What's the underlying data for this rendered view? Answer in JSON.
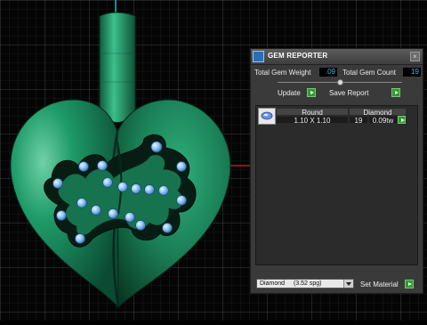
{
  "window": {
    "title": "GEM REPORTER",
    "close_glyph": "×"
  },
  "stats": {
    "weight_label": "Total Gem Weight",
    "weight_value": ".09",
    "count_label": "Total Gem Count",
    "count_value": "19"
  },
  "slider": {
    "level": 0.5
  },
  "actions": {
    "update_label": "Update",
    "save_label": "Save Report"
  },
  "gems": [
    {
      "shape": "Round",
      "material": "Diamond",
      "size": "1.10 X 1.10",
      "count": "19",
      "weight": "0.09tw"
    }
  ],
  "material": {
    "selected": "Diamond",
    "spg": "(3.52 spg)",
    "set_label": "Set Material"
  },
  "colors": {
    "accent_value": "#3fb5e8",
    "go_button": "#2e9b2e",
    "model_green": "#1f8a5c",
    "gem_blue": "#8fc4f2"
  },
  "icons": [
    "logo-icon",
    "close-icon",
    "go-arrow-icon",
    "round-gem-icon",
    "dropdown-chevron-icon"
  ]
}
